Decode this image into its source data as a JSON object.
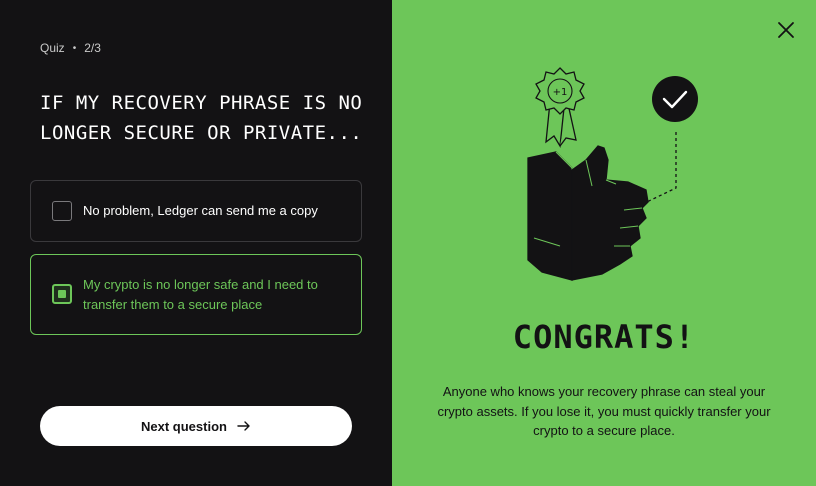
{
  "progress": {
    "fraction": 0.667
  },
  "header": {
    "section": "Quiz",
    "separator": "•",
    "step": "2/3"
  },
  "question": {
    "text": "IF MY RECOVERY PHRASE IS NO LONGER SECURE OR PRIVATE..."
  },
  "options": [
    {
      "label": "No problem, Ledger can send me a copy",
      "selected": false
    },
    {
      "label": "My crypto is no longer safe and I need to transfer them to a secure place",
      "selected": true
    }
  ],
  "actions": {
    "next_label": "Next question",
    "next_icon": "arrow-right-icon",
    "close_icon": "close-icon"
  },
  "result": {
    "title": "CONGRATS!",
    "description": "Anyone who knows your recovery phrase can steal your crypto assets. If you lose it, you must quickly transfer your crypto to a secure place."
  },
  "colors": {
    "accent": "#6dc659",
    "background": "#131214",
    "text": "#ffffff"
  }
}
